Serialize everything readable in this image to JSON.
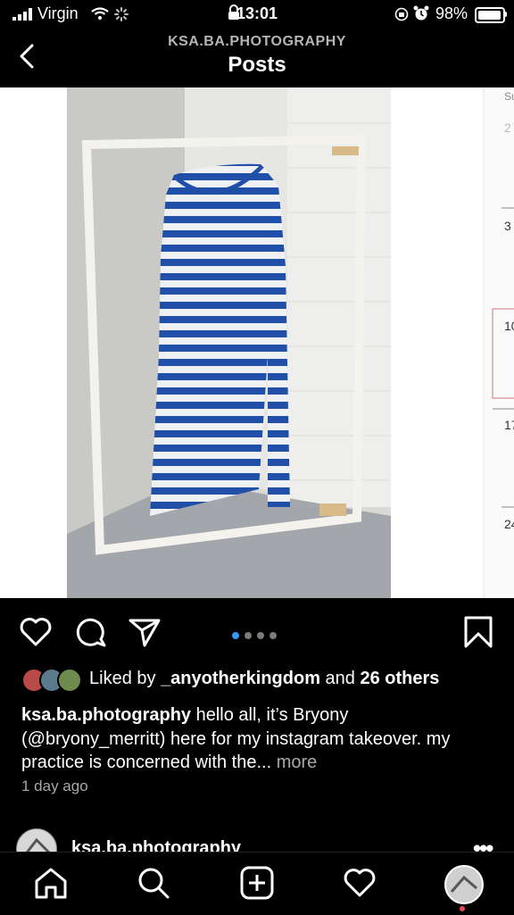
{
  "status_bar": {
    "carrier": "Virgin",
    "time": "13:01",
    "battery_percent": "98%",
    "battery_level": 0.98
  },
  "header": {
    "account": "KSA.BA.PHOTOGRAPHY",
    "title": "Posts"
  },
  "post": {
    "carousel": {
      "total": 4,
      "current": 1
    },
    "liked_by_prefix": "Liked by ",
    "liked_by_user": "_anyotherkingdom",
    "liked_by_and": " and ",
    "liked_by_others": "26 others",
    "caption_user": "ksa.ba.photography",
    "caption_text": " hello all, it’s Bryony (@bryony_merritt) here for my instagram takeover. my practice is concerned with the... ",
    "caption_more": "more",
    "time_ago": "1 day ago"
  },
  "next_post": {
    "username": "ksa.ba.photography",
    "more": "•••"
  },
  "tabs": [
    "home-icon",
    "search-icon",
    "new-post-icon",
    "activity-icon",
    "profile-avatar"
  ],
  "colors": {
    "accent": "#3897f0",
    "notification": "#ed4956",
    "stripe_blue": "#1f4fa8"
  }
}
